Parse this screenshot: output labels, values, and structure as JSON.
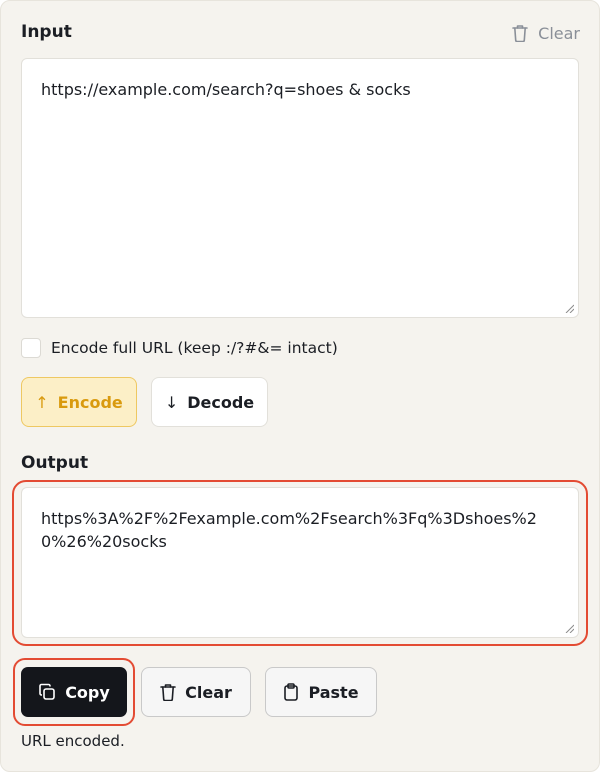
{
  "input": {
    "label": "Input",
    "clear_label": "Clear",
    "value": "https://example.com/search?q=shoes & socks"
  },
  "options": {
    "encode_full_url_label": "Encode full URL (keep :/?#&= intact)",
    "encode_full_url_checked": false
  },
  "actions": {
    "encode_label": "Encode",
    "encode_icon": "↑",
    "decode_label": "Decode",
    "decode_icon": "↓",
    "active_mode": "encode"
  },
  "output": {
    "label": "Output",
    "value": "https%3A%2F%2Fexample.com%2Fsearch%3Fq%3Dshoes%20%26%20socks"
  },
  "output_actions": {
    "copy_label": "Copy",
    "clear_label": "Clear",
    "paste_label": "Paste"
  },
  "status": {
    "message": "URL encoded."
  },
  "colors": {
    "panel_bg": "#f5f3ee",
    "accent": "#d99a0e",
    "accent_bg": "#fcefc7",
    "highlight": "#e34b33",
    "primary_dark": "#14161b"
  }
}
